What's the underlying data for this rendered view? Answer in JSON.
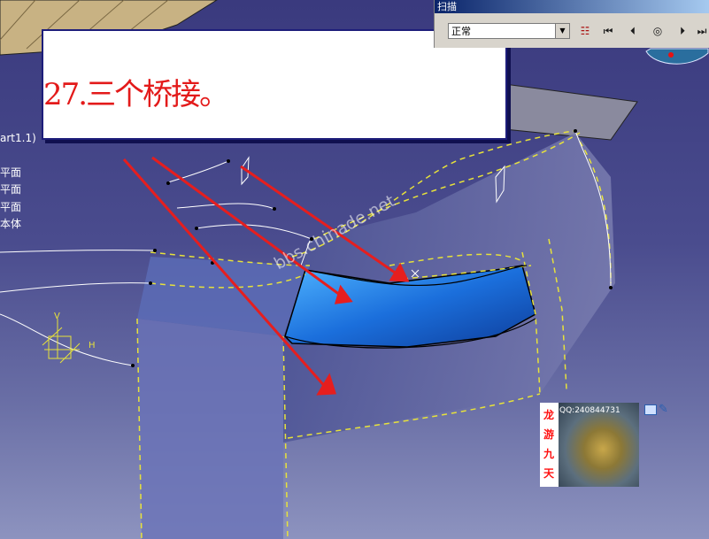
{
  "callout": {
    "text": "27.三个桥接。"
  },
  "tree": {
    "part_label": "art1.1)",
    "items": [
      "平面",
      "平面",
      "平面",
      "本体"
    ]
  },
  "scan_panel": {
    "title": "扫描",
    "select_value": "正常"
  },
  "axis": {
    "v": "V",
    "h": "H"
  },
  "watermark": "bbs.chinade.net",
  "avatar": {
    "qq": "QQ:240844731",
    "seal": [
      "龙",
      "游",
      "九",
      "天"
    ]
  },
  "colors": {
    "background": "#3a3a7e",
    "surface_highlight": "#1a7fe8",
    "arrow": "#e61e1e",
    "callout_text": "#e31a1a"
  }
}
